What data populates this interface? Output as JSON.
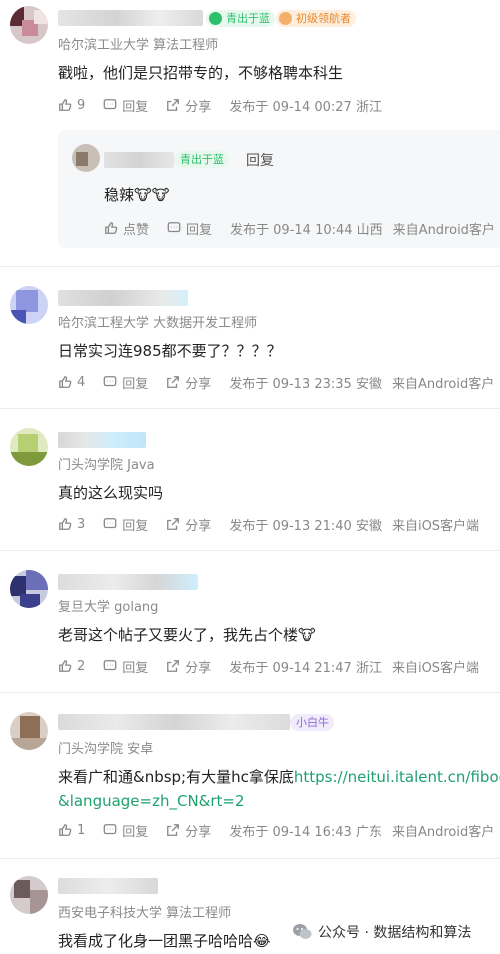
{
  "comments": [
    {
      "school": "哈尔滨工业大学 算法工程师",
      "badges": [
        "青出于蓝",
        "初级领航者"
      ],
      "text": "戳啦，他们是只招带专的，不够格聘本科生",
      "likes": "9",
      "reply_label": "回复",
      "share_label": "分享",
      "published": "发布于 09-14 00:27 浙江",
      "reply": {
        "badge": "青出于蓝",
        "reply_label": "回复",
        "text": "稳辣🐮🐮",
        "like_label": "点赞",
        "reply_action": "回复",
        "published": "发布于 09-14 10:44 山西",
        "source": "来自Android客户"
      }
    },
    {
      "school": "哈尔滨工程大学 大数据开发工程师",
      "text": "日常实习连985都不要了？？？？",
      "likes": "4",
      "reply_label": "回复",
      "share_label": "分享",
      "published": "发布于 09-13 23:35 安徽",
      "source": "来自Android客户"
    },
    {
      "school": "门头沟学院 Java",
      "text": "真的这么现实吗",
      "likes": "3",
      "reply_label": "回复",
      "share_label": "分享",
      "published": "发布于 09-13 21:40 安徽",
      "source": "来自iOS客户端"
    },
    {
      "school": "复旦大学 golang",
      "text": "老哥这个帖子又要火了，我先占个楼🐮",
      "likes": "2",
      "reply_label": "回复",
      "share_label": "分享",
      "published": "发布于 09-14 21:47 浙江",
      "source": "来自iOS客户端"
    },
    {
      "school": "门头沟学院 安卓",
      "badge": "小白牛",
      "text_prefix": "来看广和通&nbsp;有大量hc拿保底",
      "text_link": "https://neitui.italent.cn/fiboc",
      "text_line2": "&language=zh_CN&rt=2",
      "likes": "1",
      "reply_label": "回复",
      "share_label": "分享",
      "published": "发布于 09-14 16:43 广东",
      "source": "来自Android客户"
    },
    {
      "school": "西安电子科技大学 算法工程师",
      "text": "我看成了化身一团黑子哈哈哈😂"
    }
  ],
  "watermark": "公众号 · 数据结构和算法",
  "colors": {
    "link": "#1fa06f",
    "badge_green": "#2fbf6b",
    "badge_orange": "#e8892c"
  }
}
